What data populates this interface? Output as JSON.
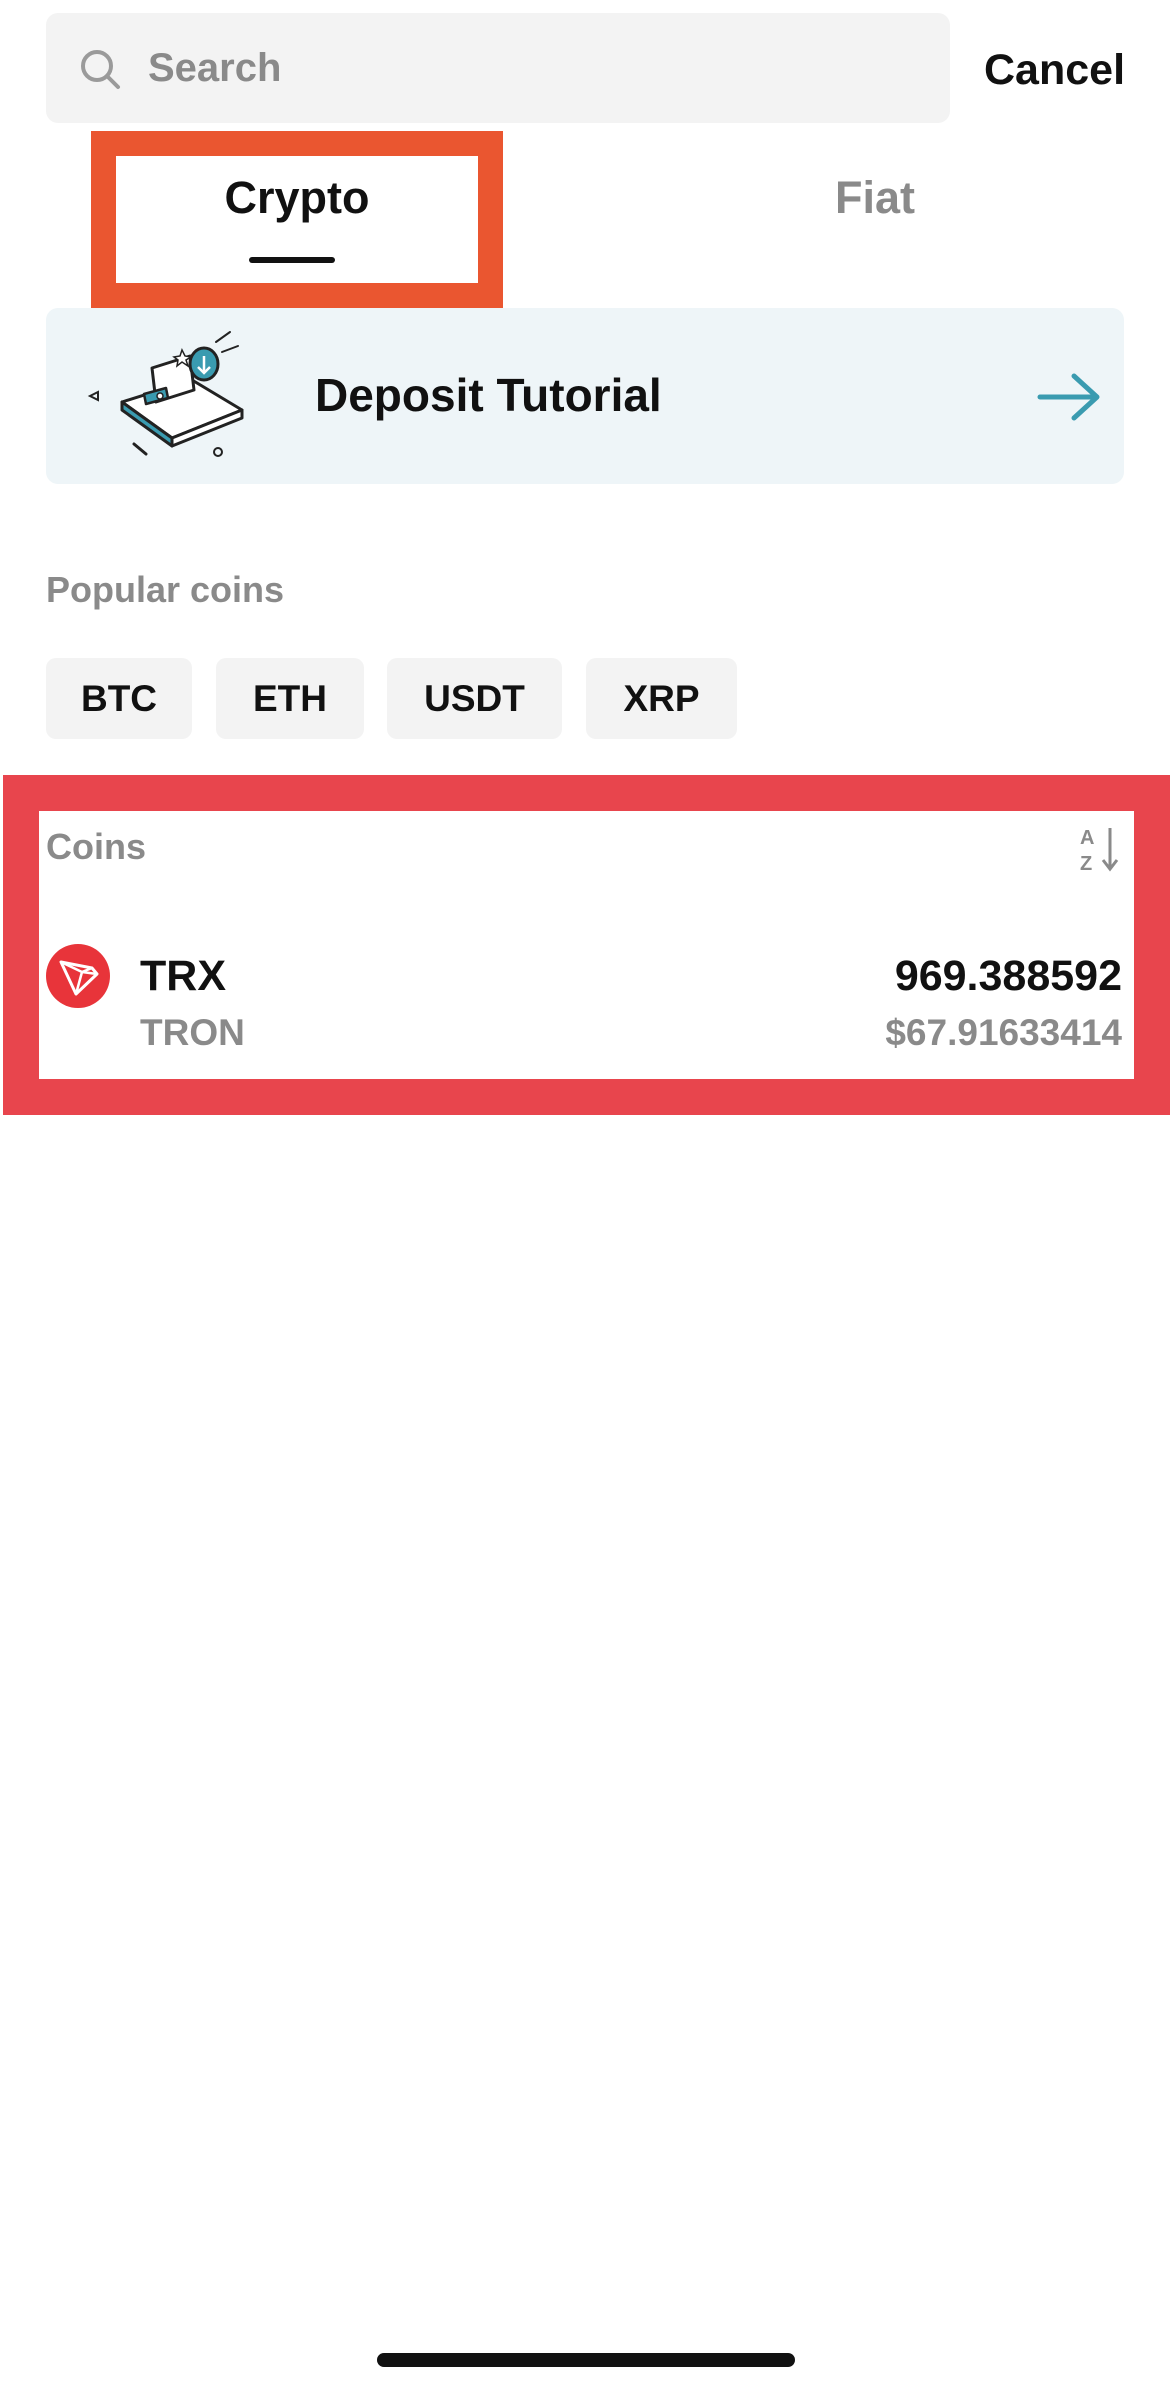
{
  "search": {
    "placeholder": "Search",
    "value": "",
    "cancel_label": "Cancel"
  },
  "tabs": [
    {
      "label": "Crypto",
      "active": true
    },
    {
      "label": "Fiat",
      "active": false
    }
  ],
  "tutorial": {
    "label": "Deposit Tutorial",
    "icon": "arrow-right-icon"
  },
  "popular": {
    "title": "Popular coins",
    "chips": [
      "BTC",
      "ETH",
      "USDT",
      "XRP"
    ]
  },
  "coins": {
    "title": "Coins",
    "sort_icon": "sort-alpha-icon",
    "items": [
      {
        "symbol": "TRX",
        "name": "TRON",
        "amount": "969.388592",
        "value": "$67.91633414",
        "icon": "tron-logo-icon"
      }
    ]
  },
  "colors": {
    "accent": "#3a9bb0",
    "tron_red": "#e8343a",
    "highlight_orange": "#ea5630",
    "highlight_red": "#e8454d",
    "muted_text": "#8a8a8a",
    "chip_bg": "#f3f3f3",
    "card_bg": "#eef5f8"
  }
}
